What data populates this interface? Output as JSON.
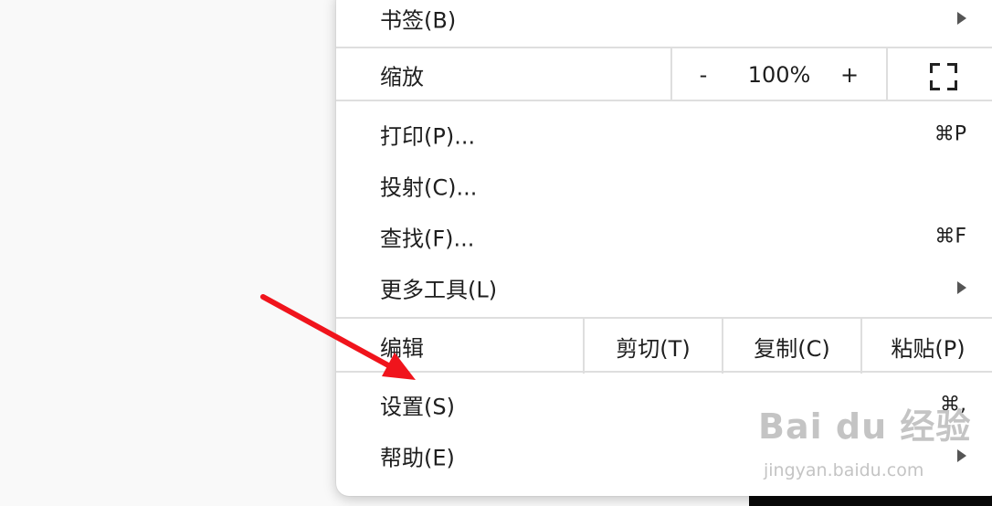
{
  "menu": {
    "bookmarks": {
      "label": "书签(B)"
    },
    "zoom": {
      "label": "缩放",
      "minus": "-",
      "level": "100%",
      "plus": "+"
    },
    "print": {
      "label": "打印(P)...",
      "shortcut": "⌘P"
    },
    "cast": {
      "label": "投射(C)..."
    },
    "find": {
      "label": "查找(F)...",
      "shortcut": "⌘F"
    },
    "more_tools": {
      "label": "更多工具(L)"
    },
    "edit": {
      "label": "编辑",
      "cut": "剪切(T)",
      "copy": "复制(C)",
      "paste": "粘贴(P)"
    },
    "settings": {
      "label": "设置(S)",
      "shortcut": "⌘,"
    },
    "help": {
      "label": "帮助(E)"
    }
  },
  "watermark": {
    "main": "Bai du 经验",
    "sub": "jingyan.baidu.com"
  },
  "colors": {
    "arrow": "#f0141c",
    "menu_bg": "#ffffff",
    "separator": "#dedede"
  }
}
